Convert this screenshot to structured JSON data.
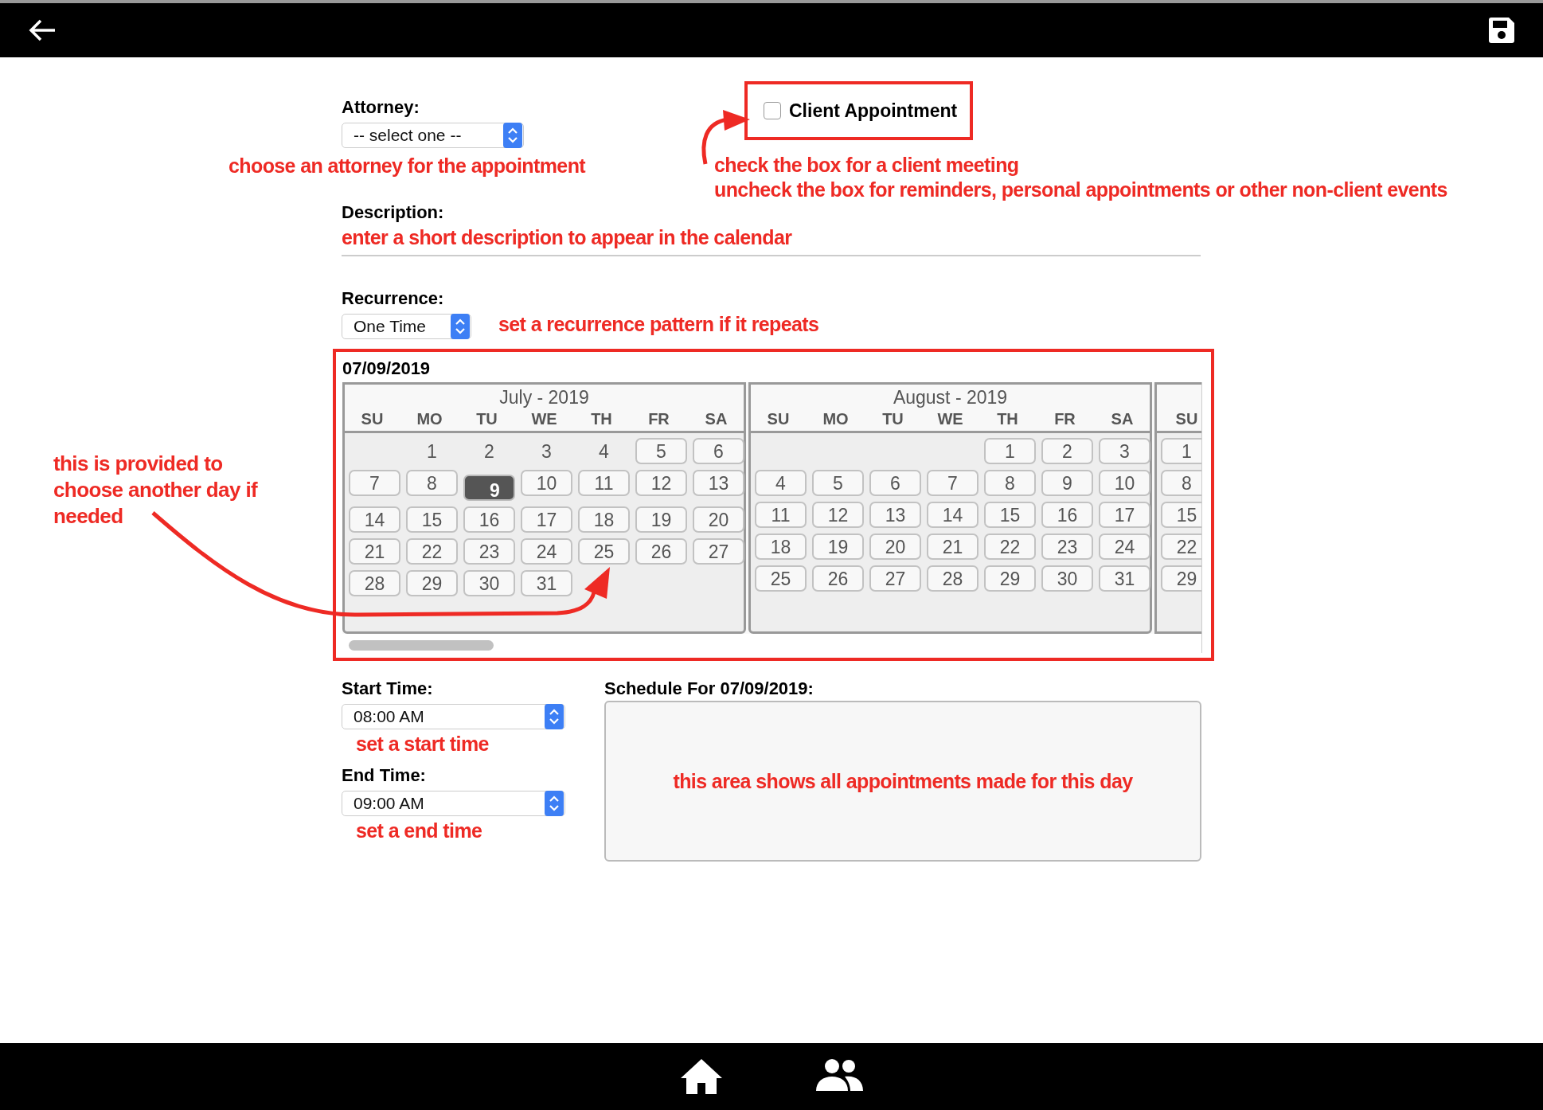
{
  "attorney": {
    "label": "Attorney:",
    "value": "-- select one --",
    "note": "choose an attorney for the appointment"
  },
  "client_appointment": {
    "label": "Client Appointment",
    "checked": false,
    "notes": [
      "check the box for a client meeting",
      "uncheck the box for reminders, personal appointments or other non-client events"
    ]
  },
  "description": {
    "label": "Description:",
    "note": "enter a short description to appear in the calendar"
  },
  "recurrence": {
    "label": "Recurrence:",
    "value": "One Time",
    "note": "set a recurrence pattern if it repeats"
  },
  "calendar": {
    "selected_date": "07/09/2019",
    "note": "this is provided to choose another day if needed",
    "months": [
      {
        "title": "July - 2019",
        "weekdays": [
          "SU",
          "MO",
          "TU",
          "WE",
          "TH",
          "FR",
          "SA"
        ],
        "weeks": [
          [
            {
              "kind": "blank"
            },
            {
              "kind": "day",
              "label": "1",
              "selected": false,
              "disabled": true
            },
            {
              "kind": "day",
              "label": "2",
              "selected": false,
              "disabled": true
            },
            {
              "kind": "day",
              "label": "3",
              "selected": false,
              "disabled": true
            },
            {
              "kind": "day",
              "label": "4",
              "selected": false,
              "disabled": true
            },
            {
              "kind": "day",
              "label": "5",
              "selected": false,
              "disabled": false
            },
            {
              "kind": "day",
              "label": "6",
              "selected": false,
              "disabled": false
            }
          ],
          [
            {
              "kind": "day",
              "label": "7",
              "selected": false,
              "disabled": false
            },
            {
              "kind": "day",
              "label": "8",
              "selected": false,
              "disabled": false
            },
            {
              "kind": "day",
              "label": "9",
              "selected": true,
              "disabled": false
            },
            {
              "kind": "day",
              "label": "10",
              "selected": false,
              "disabled": false
            },
            {
              "kind": "day",
              "label": "11",
              "selected": false,
              "disabled": false
            },
            {
              "kind": "day",
              "label": "12",
              "selected": false,
              "disabled": false
            },
            {
              "kind": "day",
              "label": "13",
              "selected": false,
              "disabled": false
            }
          ],
          [
            {
              "kind": "day",
              "label": "14",
              "selected": false,
              "disabled": false
            },
            {
              "kind": "day",
              "label": "15",
              "selected": false,
              "disabled": false
            },
            {
              "kind": "day",
              "label": "16",
              "selected": false,
              "disabled": false
            },
            {
              "kind": "day",
              "label": "17",
              "selected": false,
              "disabled": false
            },
            {
              "kind": "day",
              "label": "18",
              "selected": false,
              "disabled": false
            },
            {
              "kind": "day",
              "label": "19",
              "selected": false,
              "disabled": false
            },
            {
              "kind": "day",
              "label": "20",
              "selected": false,
              "disabled": false
            }
          ],
          [
            {
              "kind": "day",
              "label": "21",
              "selected": false,
              "disabled": false
            },
            {
              "kind": "day",
              "label": "22",
              "selected": false,
              "disabled": false
            },
            {
              "kind": "day",
              "label": "23",
              "selected": false,
              "disabled": false
            },
            {
              "kind": "day",
              "label": "24",
              "selected": false,
              "disabled": false
            },
            {
              "kind": "day",
              "label": "25",
              "selected": false,
              "disabled": false
            },
            {
              "kind": "day",
              "label": "26",
              "selected": false,
              "disabled": false
            },
            {
              "kind": "day",
              "label": "27",
              "selected": false,
              "disabled": false
            }
          ],
          [
            {
              "kind": "day",
              "label": "28",
              "selected": false,
              "disabled": false
            },
            {
              "kind": "day",
              "label": "29",
              "selected": false,
              "disabled": false
            },
            {
              "kind": "day",
              "label": "30",
              "selected": false,
              "disabled": false
            },
            {
              "kind": "day",
              "label": "31",
              "selected": false,
              "disabled": false
            }
          ]
        ]
      },
      {
        "title": "August - 2019",
        "weekdays": [
          "SU",
          "MO",
          "TU",
          "WE",
          "TH",
          "FR",
          "SA"
        ],
        "weeks": [
          [
            {
              "kind": "blank"
            },
            {
              "kind": "blank"
            },
            {
              "kind": "blank"
            },
            {
              "kind": "blank"
            },
            {
              "kind": "day",
              "label": "1",
              "selected": false,
              "disabled": false
            },
            {
              "kind": "day",
              "label": "2",
              "selected": false,
              "disabled": false
            },
            {
              "kind": "day",
              "label": "3",
              "selected": false,
              "disabled": false
            }
          ],
          [
            {
              "kind": "day",
              "label": "4",
              "selected": false,
              "disabled": false
            },
            {
              "kind": "day",
              "label": "5",
              "selected": false,
              "disabled": false
            },
            {
              "kind": "day",
              "label": "6",
              "selected": false,
              "disabled": false
            },
            {
              "kind": "day",
              "label": "7",
              "selected": false,
              "disabled": false
            },
            {
              "kind": "day",
              "label": "8",
              "selected": false,
              "disabled": false
            },
            {
              "kind": "day",
              "label": "9",
              "selected": false,
              "disabled": false
            },
            {
              "kind": "day",
              "label": "10",
              "selected": false,
              "disabled": false
            }
          ],
          [
            {
              "kind": "day",
              "label": "11",
              "selected": false,
              "disabled": false
            },
            {
              "kind": "day",
              "label": "12",
              "selected": false,
              "disabled": false
            },
            {
              "kind": "day",
              "label": "13",
              "selected": false,
              "disabled": false
            },
            {
              "kind": "day",
              "label": "14",
              "selected": false,
              "disabled": false
            },
            {
              "kind": "day",
              "label": "15",
              "selected": false,
              "disabled": false
            },
            {
              "kind": "day",
              "label": "16",
              "selected": false,
              "disabled": false
            },
            {
              "kind": "day",
              "label": "17",
              "selected": false,
              "disabled": false
            }
          ],
          [
            {
              "kind": "day",
              "label": "18",
              "selected": false,
              "disabled": false
            },
            {
              "kind": "day",
              "label": "19",
              "selected": false,
              "disabled": false
            },
            {
              "kind": "day",
              "label": "20",
              "selected": false,
              "disabled": false
            },
            {
              "kind": "day",
              "label": "21",
              "selected": false,
              "disabled": false
            },
            {
              "kind": "day",
              "label": "22",
              "selected": false,
              "disabled": false
            },
            {
              "kind": "day",
              "label": "23",
              "selected": false,
              "disabled": false
            },
            {
              "kind": "day",
              "label": "24",
              "selected": false,
              "disabled": false
            }
          ],
          [
            {
              "kind": "day",
              "label": "25",
              "selected": false,
              "disabled": false
            },
            {
              "kind": "day",
              "label": "26",
              "selected": false,
              "disabled": false
            },
            {
              "kind": "day",
              "label": "27",
              "selected": false,
              "disabled": false
            },
            {
              "kind": "day",
              "label": "28",
              "selected": false,
              "disabled": false
            },
            {
              "kind": "day",
              "label": "29",
              "selected": false,
              "disabled": false
            },
            {
              "kind": "day",
              "label": "30",
              "selected": false,
              "disabled": false
            },
            {
              "kind": "day",
              "label": "31",
              "selected": false,
              "disabled": false
            }
          ]
        ]
      },
      {
        "weekdays": [
          "SU"
        ],
        "weeks": [
          [
            {
              "kind": "day",
              "label": "1",
              "selected": false,
              "disabled": false
            }
          ],
          [
            {
              "kind": "day",
              "label": "8",
              "selected": false,
              "disabled": false
            }
          ],
          [
            {
              "kind": "day",
              "label": "15",
              "selected": false,
              "disabled": false
            }
          ],
          [
            {
              "kind": "day",
              "label": "22",
              "selected": false,
              "disabled": false
            }
          ],
          [
            {
              "kind": "day",
              "label": "29",
              "selected": false,
              "disabled": false
            }
          ]
        ]
      }
    ]
  },
  "start_time": {
    "label": "Start Time:",
    "value": "08:00 AM",
    "note": "set a start time"
  },
  "end_time": {
    "label": "End Time:",
    "value": "09:00 AM",
    "note": "set a end time"
  },
  "schedule": {
    "title": "Schedule For 07/09/2019:",
    "note": "this area shows all appointments made for this day"
  }
}
